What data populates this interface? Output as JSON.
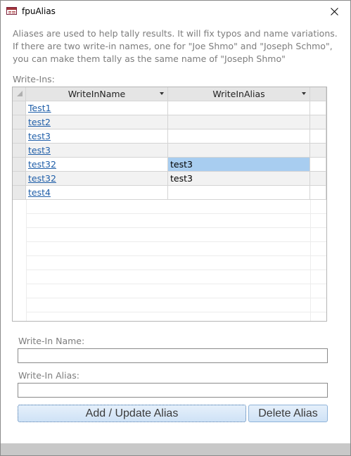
{
  "window": {
    "title": "fpuAlias"
  },
  "description": [
    "Aliases are used to help tally results. It will fix typos and name variations.",
    "If there are two write-in names, one for \"Joe Shmo\" and \"Joseph Schmo\",",
    "you can make them tally as the same name of \"Joseph Shmo\""
  ],
  "grid": {
    "label": "Write-Ins:",
    "columns": [
      "WriteInName",
      "WriteInAlias"
    ],
    "rows": [
      {
        "name": "Test1",
        "alias": ""
      },
      {
        "name": "test2",
        "alias": ""
      },
      {
        "name": "test3",
        "alias": ""
      },
      {
        "name": "test3",
        "alias": ""
      },
      {
        "name": "test32",
        "alias": "test3",
        "selected": true
      },
      {
        "name": "test32",
        "alias": "test3"
      },
      {
        "name": "test4",
        "alias": ""
      }
    ]
  },
  "form": {
    "name_label": "Write-In Name:",
    "name_value": "",
    "alias_label": "Write-In Alias:",
    "alias_value": ""
  },
  "buttons": {
    "add_label": "Add / Update Alias",
    "delete_label": "Delete Alias"
  },
  "icons": {
    "app": "form-icon",
    "close": "close-icon",
    "sort": "dropdown-arrow-icon"
  },
  "colors": {
    "link": "#1f5ea8",
    "selected_cell": "#a8cdf0",
    "button_bg": "#cfe2f6"
  }
}
